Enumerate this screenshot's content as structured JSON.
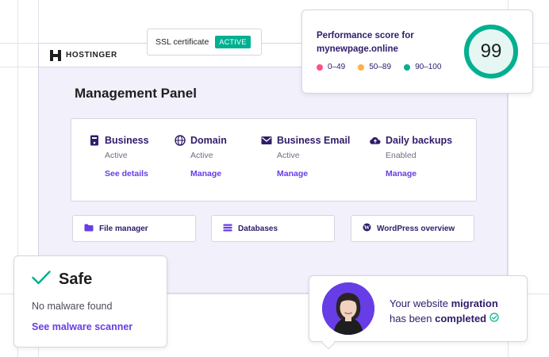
{
  "brand": {
    "logo_text": "HOSTINGER"
  },
  "ssl": {
    "label": "SSL certificate",
    "status": "ACTIVE"
  },
  "performance": {
    "title_line1": "Performance score for",
    "title_line2": "mynewpage.online",
    "score": "99",
    "score_fraction": 0.99,
    "legend": [
      {
        "label": "0–49",
        "color": "#fc5185"
      },
      {
        "label": "50–89",
        "color": "#ffb04a"
      },
      {
        "label": "90–100",
        "color": "#00b090"
      }
    ]
  },
  "panel": {
    "title": "Management Panel"
  },
  "services": [
    {
      "name": "Business",
      "status": "Active",
      "link": "See details",
      "icon": "server-icon"
    },
    {
      "name": "Domain",
      "status": "Active",
      "link": "Manage",
      "icon": "globe-www-icon"
    },
    {
      "name": "Business Email",
      "status": "Active",
      "link": "Manage",
      "icon": "envelope-icon"
    },
    {
      "name": "Daily backups",
      "status": "Enabled",
      "link": "Manage",
      "icon": "cloud-upload-icon"
    }
  ],
  "tools": [
    {
      "label": "File manager",
      "icon": "folder-icon"
    },
    {
      "label": "Databases",
      "icon": "database-icon"
    },
    {
      "label": "WordPress overview",
      "icon": "wordpress-icon"
    }
  ],
  "safe": {
    "title": "Safe",
    "description": "No malware found",
    "link": "See malware scanner"
  },
  "migration": {
    "line1_prefix": "Your website ",
    "line1_bold": "migration",
    "line2_prefix": "has been ",
    "line2_bold": "completed"
  },
  "colors": {
    "accent": "#673de6",
    "navy": "#2f1c6a",
    "success": "#00b090"
  }
}
